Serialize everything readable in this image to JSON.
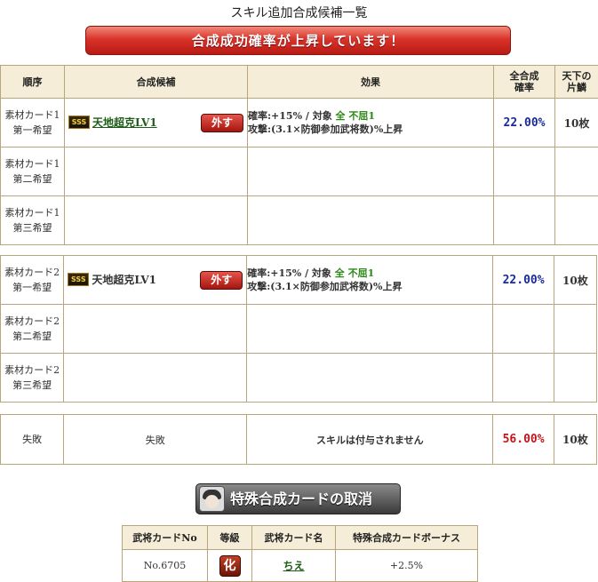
{
  "page_title": "スキル追加合成候補一覧",
  "banner_text": "合成成功確率が上昇しています！",
  "table": {
    "headers": {
      "order": "順序",
      "candidate": "合成候補",
      "effect": "効果",
      "total_prob": "全合成\n確率",
      "tenka": "天下の\n片鱗"
    },
    "groups": [
      {
        "rows": [
          {
            "order_line1": "素材カード1",
            "order_line2": "第一希望",
            "rank_badge": "SSS",
            "skill": "天地超克LV1",
            "remove_label": "外す",
            "effect_line1_a": "確率:+15% / 対象 ",
            "effect_line1_b": "全 不屈1",
            "effect_line2": "攻撃:(3.1×防御参加武将数)%上昇",
            "prob": "22.00%",
            "tenka": "10枚",
            "linked": true
          },
          {
            "order_line1": "素材カード1",
            "order_line2": "第二希望",
            "skill": "",
            "prob": "",
            "tenka": ""
          },
          {
            "order_line1": "素材カード1",
            "order_line2": "第三希望",
            "skill": "",
            "prob": "",
            "tenka": ""
          }
        ]
      },
      {
        "rows": [
          {
            "order_line1": "素材カード2",
            "order_line2": "第一希望",
            "rank_badge": "SSS",
            "skill": "天地超克LV1",
            "remove_label": "外す",
            "effect_line1_a": "確率:+15% / 対象 ",
            "effect_line1_b": "全 不屈1",
            "effect_line2": "攻撃:(3.1×防御参加武将数)%上昇",
            "prob": "22.00%",
            "tenka": "10枚",
            "linked": false
          },
          {
            "order_line1": "素材カード2",
            "order_line2": "第二希望",
            "skill": "",
            "prob": "",
            "tenka": ""
          },
          {
            "order_line1": "素材カード2",
            "order_line2": "第三希望",
            "skill": "",
            "prob": "",
            "tenka": ""
          }
        ]
      }
    ],
    "fail_row": {
      "order": "失敗",
      "candidate": "失敗",
      "effect": "スキルは付与されません",
      "prob": "56.00%",
      "tenka": "10枚"
    }
  },
  "cancel_button_label": "特殊合成カードの取消",
  "card_table": {
    "headers": {
      "no": "武将カードNo",
      "rank": "等級",
      "name": "武将カード名",
      "bonus": "特殊合成カードボーナス"
    },
    "row": {
      "no": "No.6705",
      "rank": "化",
      "name": "ちえ",
      "bonus": "+2.5%"
    }
  },
  "colors": {
    "banner": "#c8261c",
    "prob_blue": "#1a2a9e",
    "prob_red": "#c0151a",
    "skill_green": "#1e5d18",
    "border": "#b8a57c",
    "header_bg": "#f5edd7"
  }
}
